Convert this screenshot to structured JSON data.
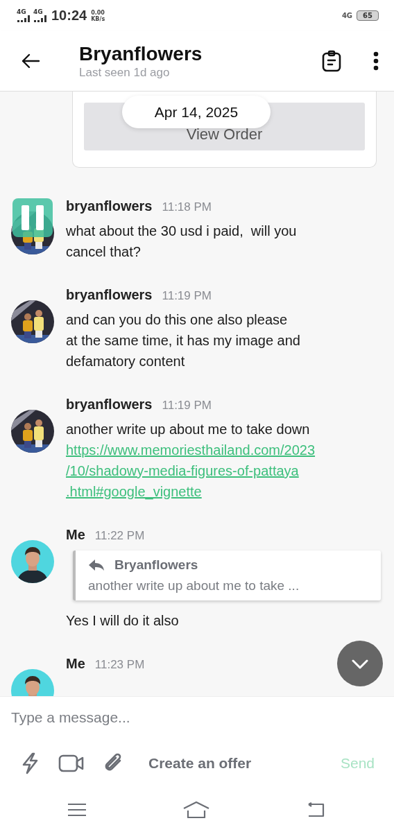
{
  "status_bar": {
    "signal_1": "4G",
    "signal_2": "4G",
    "time": "10:24",
    "speed": "0.00",
    "speed_unit": "KB/s",
    "network": "4G",
    "battery": "65"
  },
  "header": {
    "title": "Bryanflowers",
    "subtitle": "Last seen 1d ago"
  },
  "order_card": {
    "button": "View Order"
  },
  "date_separator": "Apr 14, 2025",
  "messages": [
    {
      "kind": "contact",
      "sender": "bryanflowers",
      "time": "11:18 PM",
      "text": "what about the 30 usd i paid,  will you\ncancel that?",
      "pause_overlay": true
    },
    {
      "kind": "contact",
      "sender": "bryanflowers",
      "time": "11:19 PM",
      "text": "and can you do this one also please\nat the same time, it has my image and\ndefamatory content"
    },
    {
      "kind": "contact",
      "sender": "bryanflowers",
      "time": "11:19 PM",
      "text": "another write up about me to take down",
      "link": "https://www.memoriesthailand.com/2023\n/10/shadowy-media-figures-of-pattaya\n.html#google_vignette"
    },
    {
      "kind": "me",
      "sender": "Me",
      "time": "11:22 PM",
      "reply": {
        "sender": "Bryanflowers",
        "text": "another write up about me to take ..."
      },
      "text": "Yes I will do it also"
    },
    {
      "kind": "me",
      "sender": "Me",
      "time": "11:23 PM"
    }
  ],
  "composer": {
    "placeholder": "Type a message...",
    "offer_button": "Create an offer",
    "send_button": "Send",
    "send_disabled": true
  }
}
